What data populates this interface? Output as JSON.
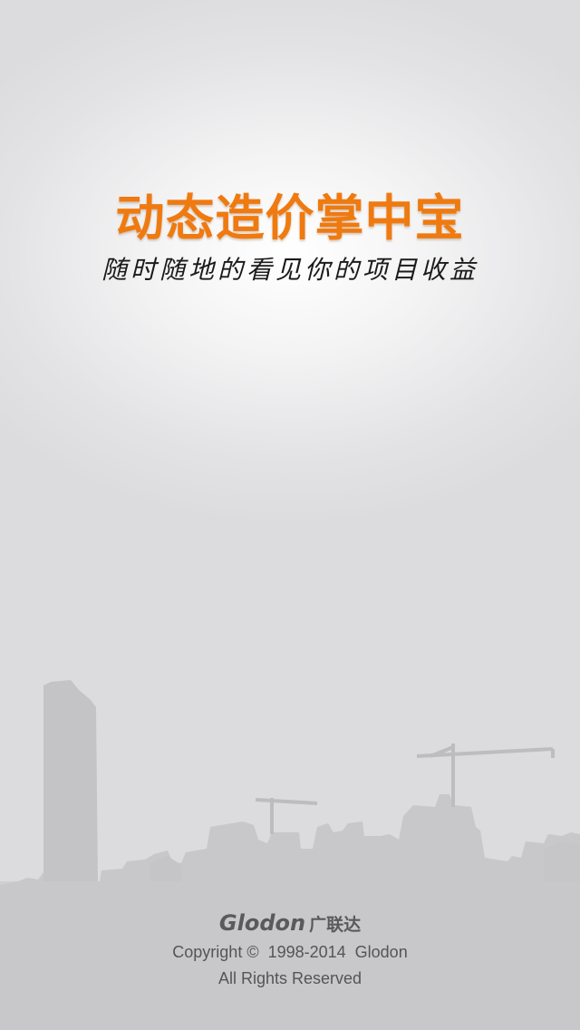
{
  "splash": {
    "title": "动态造价掌中宝",
    "subtitle": "随时随地的看见你的项目收益",
    "accent_color": "#ef7a10"
  },
  "footer": {
    "brand_latin": "Glodon",
    "brand_chinese": "广联达",
    "copyright": "Copyright ©  1998-2014  Glodon",
    "rights": "All Rights Reserved"
  }
}
